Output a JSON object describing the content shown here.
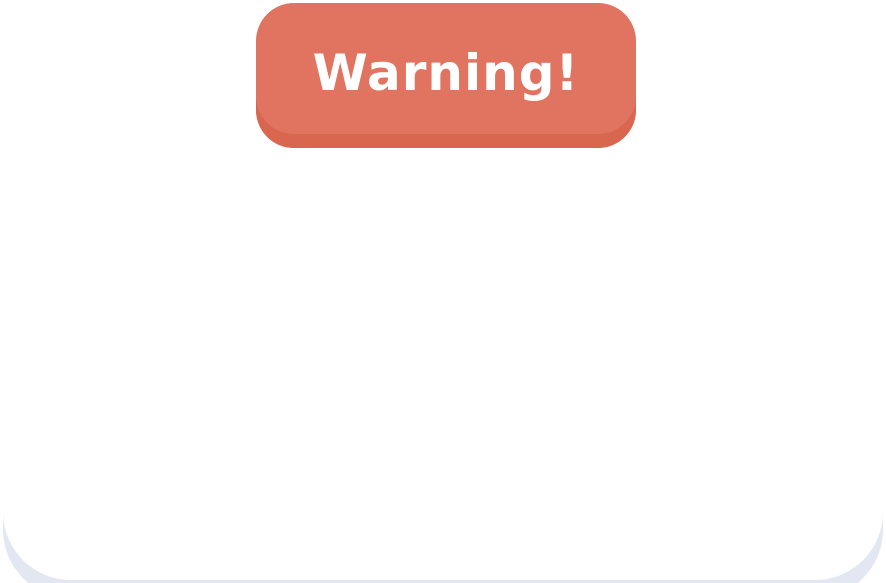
{
  "dialog": {
    "title": "Warning!",
    "title_bg_color": "#e07460",
    "title_text_color": "#ffffff",
    "body_bg_color": "#ffffff",
    "base_shadow_color": "#e3e7f1"
  }
}
